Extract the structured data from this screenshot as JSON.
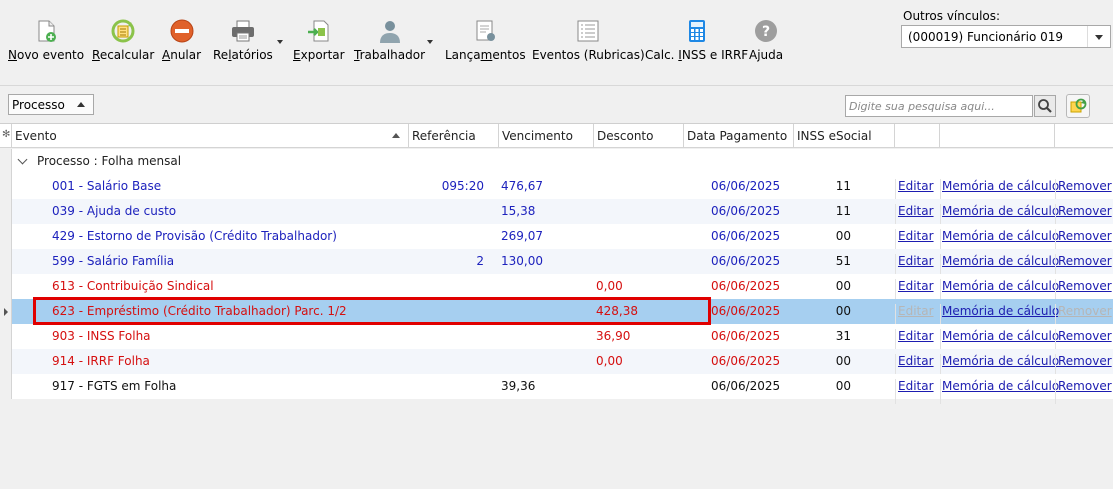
{
  "toolbar": {
    "buttons": [
      {
        "label": "Novo evento",
        "icon": "new-document-icon",
        "accel": "N",
        "rest": "ovo evento"
      },
      {
        "label": "Recalcular",
        "icon": "recalculate-icon",
        "accel": "R",
        "rest": "ecalcular"
      },
      {
        "label": "Anular",
        "icon": "cancel-icon",
        "accel": "A",
        "rest": "nular"
      },
      {
        "label": "Relatórios",
        "icon": "printer-icon",
        "pre": "Re",
        "accel": "l",
        "rest": "atórios"
      },
      {
        "label": "Exportar",
        "icon": "export-icon",
        "accel": "E",
        "rest": "xportar"
      },
      {
        "label": "Trabalhador",
        "icon": "worker-icon",
        "accel": "T",
        "rest": "rabalhador"
      },
      {
        "label": "Lançamentos",
        "icon": "entries-icon",
        "pre": "Lança",
        "accel": "m",
        "rest": "entos"
      },
      {
        "label": "Eventos (Rubricas)",
        "icon": "list-icon"
      },
      {
        "label": "Calc. INSS e IRRF",
        "icon": "calculator-icon",
        "pre": "Calc. ",
        "accel": "I",
        "rest": "NSS e IRRF"
      },
      {
        "label": "Ajuda",
        "icon": "help-icon"
      }
    ],
    "outros_vinculos_label": "Outros vínculos:",
    "outros_vinculos_value": "(000019) Funcionário 019"
  },
  "filter": {
    "group_by": "Processo",
    "search_placeholder": "Digite sua pesquisa aqui..."
  },
  "grid": {
    "columns": [
      "Evento",
      "Referência",
      "Vencimento",
      "Desconto",
      "Data Pagamento",
      "INSS eSocial",
      "",
      "",
      ""
    ],
    "group_label": "Processo : Folha mensal",
    "rows": [
      {
        "evento": "001 - Salário Base",
        "referencia": "095:20",
        "vencimento": "476,67",
        "desconto": "",
        "data": "06/06/2025",
        "inss": "11",
        "color": "blue"
      },
      {
        "evento": "039 - Ajuda de custo",
        "referencia": "",
        "vencimento": "15,38",
        "desconto": "",
        "data": "06/06/2025",
        "inss": "11",
        "color": "blue"
      },
      {
        "evento": "429 - Estorno de Provisão (Crédito Trabalhador)",
        "referencia": "",
        "vencimento": "269,07",
        "desconto": "",
        "data": "06/06/2025",
        "inss": "00",
        "color": "blue"
      },
      {
        "evento": "599 - Salário Família",
        "referencia": "2",
        "vencimento": "130,00",
        "desconto": "",
        "data": "06/06/2025",
        "inss": "51",
        "color": "blue"
      },
      {
        "evento": "613 - Contribuição Sindical",
        "referencia": "",
        "vencimento": "",
        "desconto": "0,00",
        "data": "06/06/2025",
        "inss": "00",
        "color": "red"
      },
      {
        "evento": "623 - Empréstimo (Crédito Trabalhador) Parc. 1/2",
        "referencia": "",
        "vencimento": "",
        "desconto": "428,38",
        "data": "06/06/2025",
        "inss": "00",
        "color": "red",
        "selected": true
      },
      {
        "evento": "903 - INSS Folha",
        "referencia": "",
        "vencimento": "",
        "desconto": "36,90",
        "data": "06/06/2025",
        "inss": "31",
        "color": "red"
      },
      {
        "evento": "914 - IRRF Folha",
        "referencia": "",
        "vencimento": "",
        "desconto": "0,00",
        "data": "06/06/2025",
        "inss": "00",
        "color": "red"
      },
      {
        "evento": "917 - FGTS em Folha",
        "referencia": "",
        "vencimento": "39,36",
        "desconto": "",
        "data": "06/06/2025",
        "inss": "00",
        "color": "black"
      }
    ],
    "link_editar": "Editar",
    "link_memoria": "Memória de cálculo",
    "link_remover": "Remover"
  },
  "colors": {
    "income": "#1d22bd",
    "deduction": "#d50f0f",
    "selected_row": "#a6cff0",
    "highlight_border": "#e00000"
  }
}
